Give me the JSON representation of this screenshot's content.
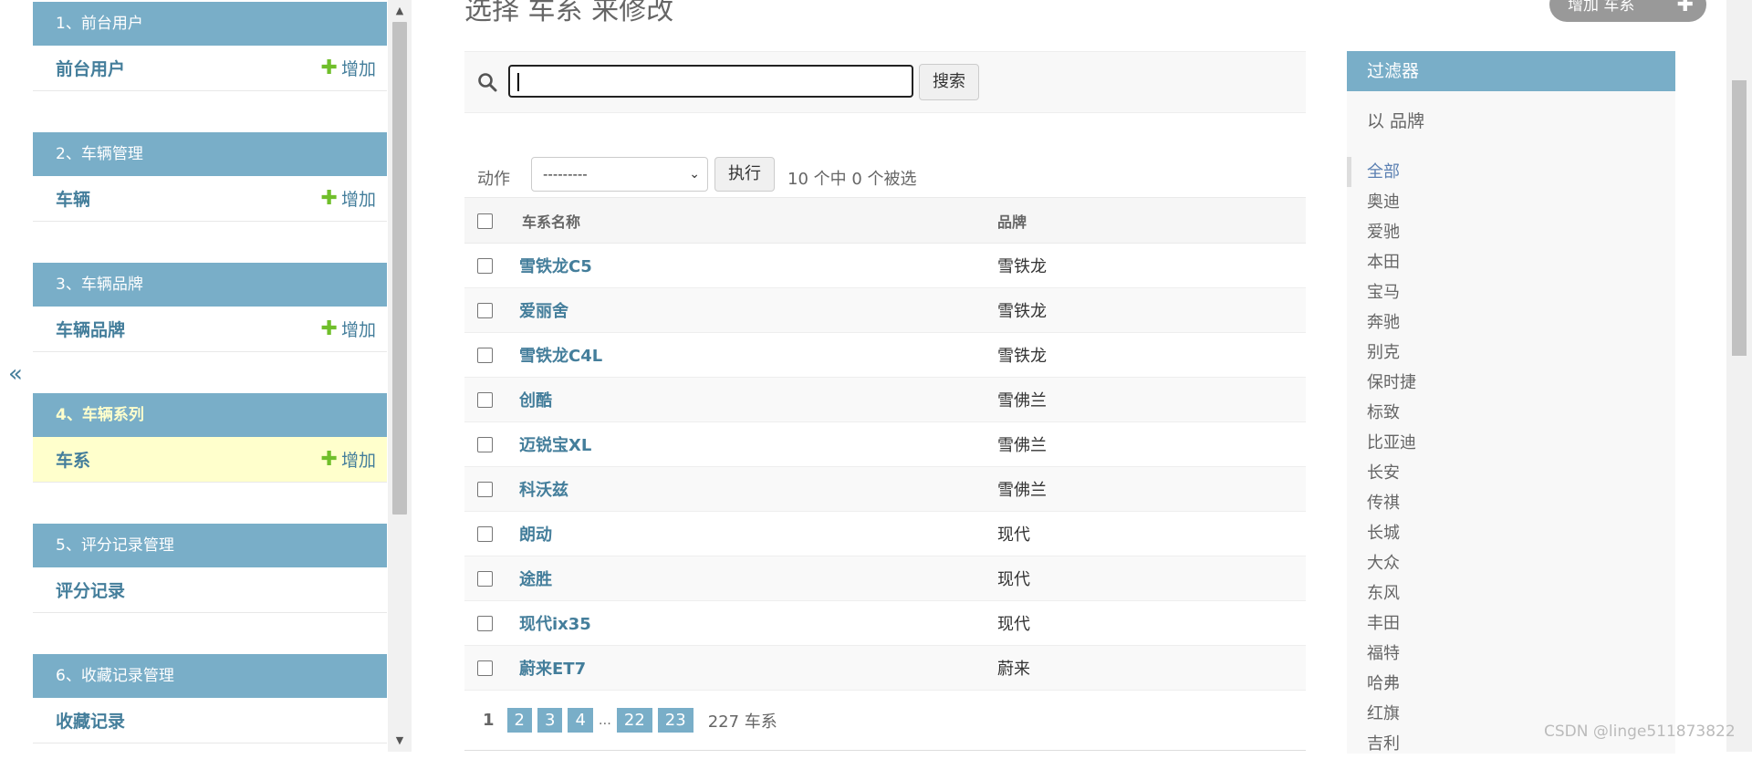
{
  "sidebar_toggle": "«",
  "sidebar": {
    "modules": [
      {
        "caption": "1、前台用户",
        "model": "前台用户",
        "add": "增加"
      },
      {
        "caption": "2、车辆管理",
        "model": "车辆",
        "add": "增加"
      },
      {
        "caption": "3、车辆品牌",
        "model": "车辆品牌",
        "add": "增加"
      },
      {
        "caption": "4、车辆系列",
        "model": "车系",
        "add": "增加"
      },
      {
        "caption": "5、评分记录管理",
        "model": "评分记录",
        "add": ""
      },
      {
        "caption": "6、收藏记录管理",
        "model": "收藏记录",
        "add": ""
      }
    ]
  },
  "main": {
    "title": "选择 车系 来修改",
    "add_button": "增加 车系",
    "search": {
      "value": "",
      "button": "搜索"
    },
    "actions": {
      "label": "动作",
      "selected": "---------",
      "go": "执行",
      "counter": "10 个中 0 个被选"
    },
    "columns": [
      "车系名称",
      "品牌"
    ],
    "rows": [
      {
        "name": "雪铁龙C5",
        "brand": "雪铁龙"
      },
      {
        "name": "爱丽舍",
        "brand": "雪铁龙"
      },
      {
        "name": "雪铁龙C4L",
        "brand": "雪铁龙"
      },
      {
        "name": "创酷",
        "brand": "雪佛兰"
      },
      {
        "name": "迈锐宝XL",
        "brand": "雪佛兰"
      },
      {
        "name": "科沃兹",
        "brand": "雪佛兰"
      },
      {
        "name": "朗动",
        "brand": "现代"
      },
      {
        "name": "途胜",
        "brand": "现代"
      },
      {
        "name": "现代ix35",
        "brand": "现代"
      },
      {
        "name": "蔚来ET7",
        "brand": "蔚来"
      }
    ],
    "pagination": {
      "current": "1",
      "pages": [
        "2",
        "3",
        "4"
      ],
      "ellipsis": "…",
      "last_pages": [
        "22",
        "23"
      ],
      "count": "227 车系"
    }
  },
  "filter": {
    "title": "过滤器",
    "group": "以 品牌",
    "items": [
      "全部",
      "奥迪",
      "爱驰",
      "本田",
      "宝马",
      "奔驰",
      "别克",
      "保时捷",
      "标致",
      "比亚迪",
      "长安",
      "传祺",
      "长城",
      "大众",
      "东风",
      "丰田",
      "福特",
      "哈弗",
      "红旗",
      "吉利"
    ]
  },
  "watermark": "CSDN @linge511873822"
}
